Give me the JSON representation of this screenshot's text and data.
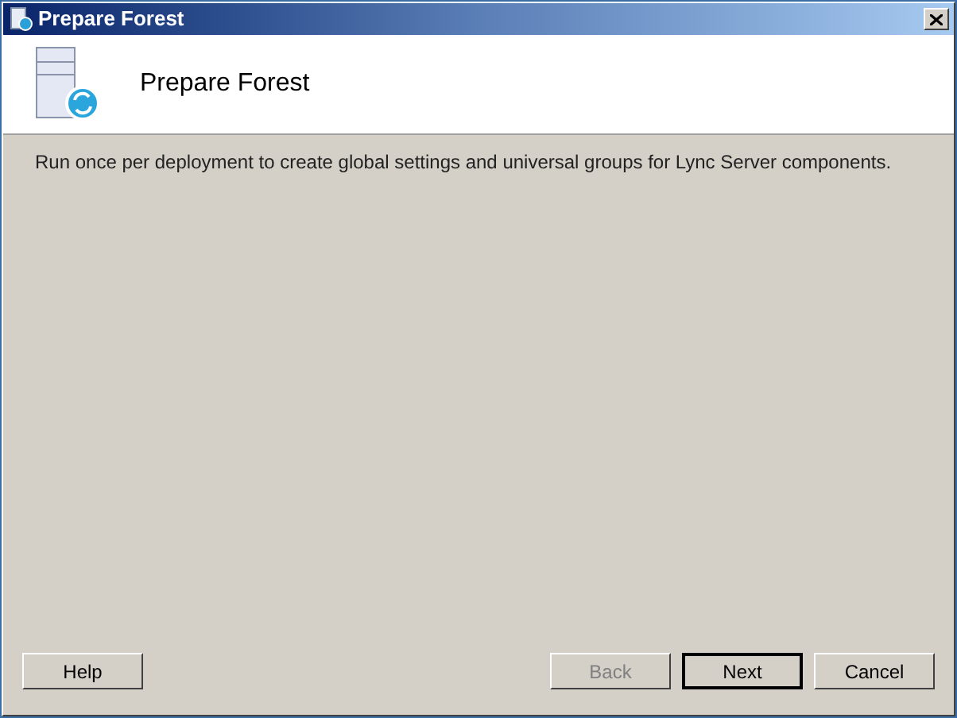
{
  "window": {
    "title": "Prepare Forest"
  },
  "header": {
    "title": "Prepare Forest"
  },
  "description": "Run once per deployment to create global settings and universal groups for Lync Server components.",
  "buttons": [
    {
      "label": "Help",
      "disabled": false,
      "default": false,
      "kind": "left"
    },
    {
      "label": "Back",
      "disabled": true,
      "default": false,
      "kind": "right"
    },
    {
      "label": "Next",
      "disabled": false,
      "default": true,
      "kind": "right"
    },
    {
      "label": "Cancel",
      "disabled": false,
      "default": false,
      "kind": "right"
    }
  ]
}
